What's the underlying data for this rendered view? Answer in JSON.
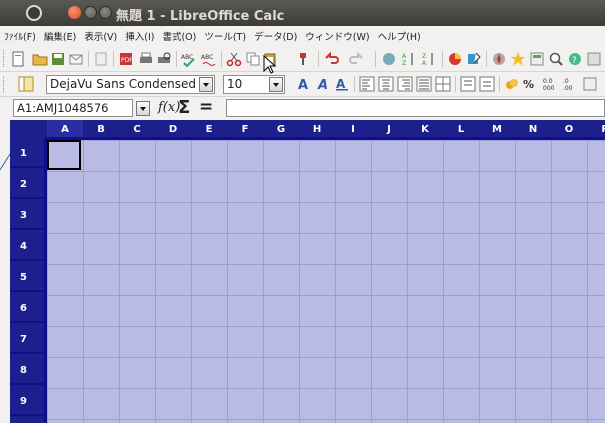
{
  "window": {
    "title": "無題 1 - LibreOffice Calc"
  },
  "menubar": {
    "items": [
      "ﾌｧｲﾙ(F)",
      "編集(E)",
      "表示(V)",
      "挿入(I)",
      "書式(O)",
      "ツール(T)",
      "データ(D)",
      "ウィンドウ(W)",
      "ヘルプ(H)"
    ]
  },
  "formatting": {
    "font_name": "DejaVu Sans Condensed",
    "font_size": "10"
  },
  "formula_bar": {
    "name_box": "A1:AMJ1048576",
    "fx_symbol": "f(x)",
    "sum_symbol": "Σ",
    "equals_symbol": "=",
    "content": ""
  },
  "grid": {
    "columns": [
      "A",
      "B",
      "C",
      "D",
      "E",
      "F",
      "G",
      "H",
      "I",
      "J",
      "K",
      "L",
      "M",
      "N",
      "O",
      "P"
    ],
    "rows": [
      "1",
      "2",
      "3",
      "4",
      "5",
      "6",
      "7",
      "8",
      "9"
    ],
    "header_color": "#1c1f8c",
    "cell_color": "#b9bbe4",
    "gridline_color": "#9c9ed6"
  }
}
